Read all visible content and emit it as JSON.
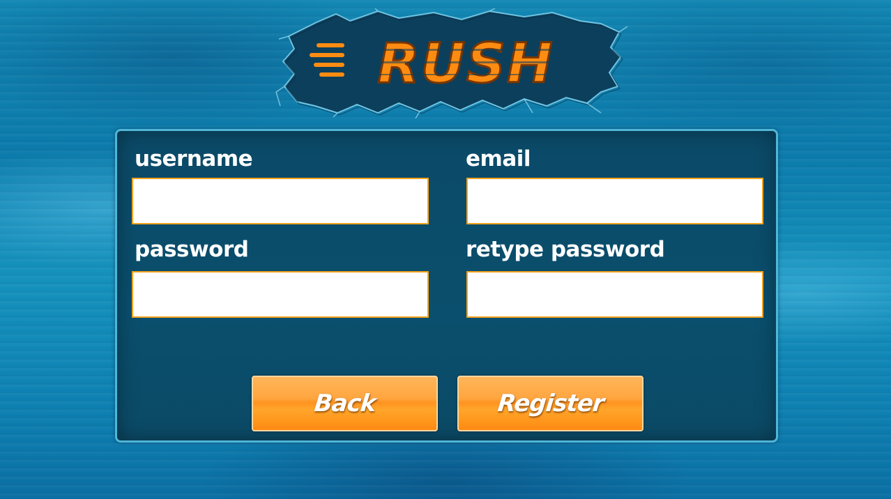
{
  "app": {
    "logo_text": "RUSH"
  },
  "form": {
    "username_label": "username",
    "email_label": "email",
    "password_label": "password",
    "retype_password_label": "retype password",
    "username_value": "",
    "email_value": "",
    "password_value": "",
    "retype_password_value": ""
  },
  "buttons": {
    "back_label": "Back",
    "register_label": "Register"
  },
  "colors": {
    "background": "#0e86b5",
    "panel": "#0b4a68",
    "panel_border": "#4fb6d8",
    "input_border": "#f3a21c",
    "button": "#ff9a24",
    "logo_letters": "#ff8c12"
  },
  "icons": {
    "logo": "rush-cracked-wall-logo"
  }
}
